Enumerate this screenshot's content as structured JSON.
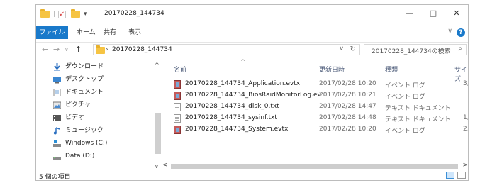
{
  "window": {
    "title": "20170228_144734",
    "minimize": "—",
    "maximize": "□",
    "close": "✕"
  },
  "ribbon": {
    "file": "ファイル",
    "tabs": [
      "ホーム",
      "共有",
      "表示"
    ],
    "expand": "∨",
    "help": "?"
  },
  "address": {
    "back": "←",
    "forward": "→",
    "recent": "∨",
    "up": "↑",
    "separator": "›",
    "path": "20170228_144734",
    "dropdown": "∨",
    "refresh": "↻",
    "search_placeholder": "20170228_144734の検索",
    "search_icon": "⌕"
  },
  "nav": {
    "items": [
      {
        "label": "ダウンロード",
        "icon": "download-icon"
      },
      {
        "label": "デスクトップ",
        "icon": "desktop-icon"
      },
      {
        "label": "ドキュメント",
        "icon": "documents-icon"
      },
      {
        "label": "ピクチャ",
        "icon": "pictures-icon"
      },
      {
        "label": "ビデオ",
        "icon": "videos-icon"
      },
      {
        "label": "ミュージック",
        "icon": "music-icon"
      },
      {
        "label": "Windows (C:)",
        "icon": "drive-c-icon"
      },
      {
        "label": "Data (D:)",
        "icon": "drive-d-icon"
      }
    ]
  },
  "columns": {
    "name": "名前",
    "modified": "更新日時",
    "type": "種類",
    "size": "サイズ",
    "sort_arrow": "^"
  },
  "files": [
    {
      "name": "20170228_144734_Application.evtx",
      "modified": "2017/02/28 10:20",
      "type": "イベント ログ",
      "size": "3,",
      "icon": "evtx"
    },
    {
      "name": "20170228_144734_BiosRaidMonitorLog.ev...",
      "modified": "2017/02/28 10:21",
      "type": "イベント ログ",
      "size": "",
      "icon": "evtx"
    },
    {
      "name": "20170228_144734_disk_0.txt",
      "modified": "2017/02/28 14:47",
      "type": "テキスト ドキュメント",
      "size": "",
      "icon": "txt"
    },
    {
      "name": "20170228_144734_sysinf.txt",
      "modified": "2017/02/28 14:48",
      "type": "テキスト ドキュメント",
      "size": "1,",
      "icon": "txt"
    },
    {
      "name": "20170228_144734_System.evtx",
      "modified": "2017/02/28 10:20",
      "type": "イベント ログ",
      "size": "2,",
      "icon": "evtx"
    }
  ],
  "status": {
    "count": "5 個の項目"
  },
  "scroll": {
    "up": "^",
    "down": "∨",
    "left": "<",
    "right": ">"
  },
  "colors": {
    "accent": "#1979ca",
    "folder": "#f6c443"
  }
}
